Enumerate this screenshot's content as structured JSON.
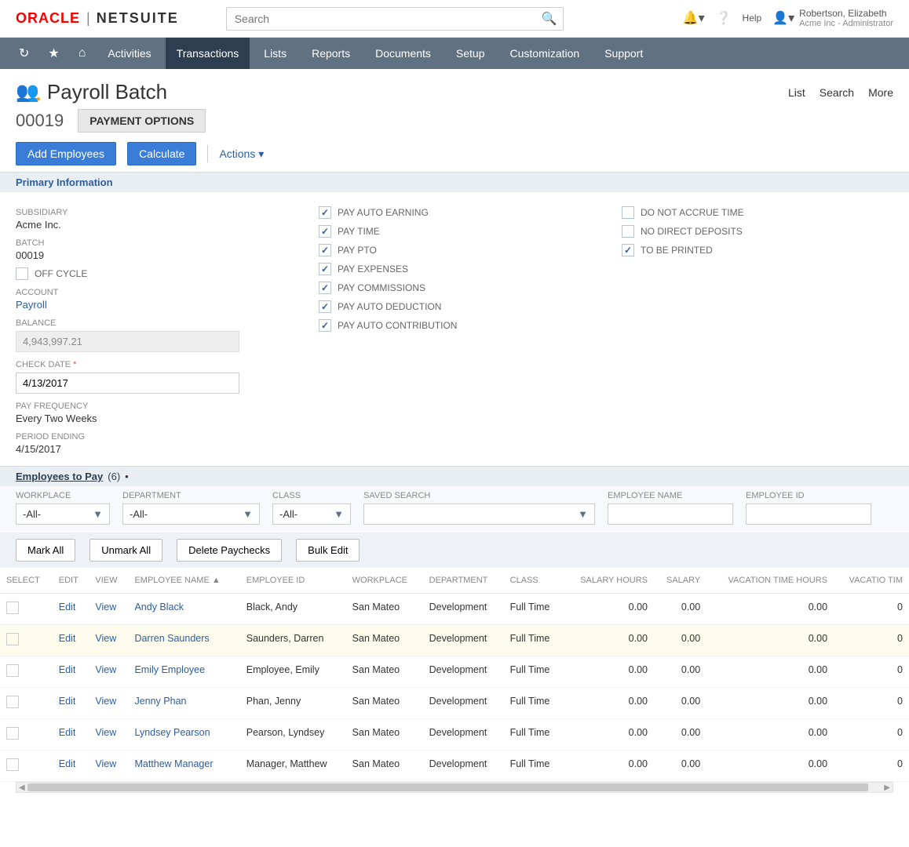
{
  "header": {
    "logo_oracle": "ORACLE",
    "logo_netsuite": "NETSUITE",
    "search_placeholder": "Search",
    "help": "Help",
    "user_name": "Robertson, Elizabeth",
    "user_role": "Acme Inc - Administrator"
  },
  "nav": [
    "Activities",
    "Transactions",
    "Lists",
    "Reports",
    "Documents",
    "Setup",
    "Customization",
    "Support"
  ],
  "nav_active": "Transactions",
  "page": {
    "title": "Payroll Batch",
    "batch_no": "00019",
    "payment_options": "PAYMENT OPTIONS",
    "top_actions": [
      "List",
      "Search",
      "More"
    ],
    "add_employees": "Add Employees",
    "calculate": "Calculate",
    "actions": "Actions"
  },
  "primary_info_header": "Primary Information",
  "col1": {
    "subsidiary_label": "SUBSIDIARY",
    "subsidiary_value": "Acme Inc.",
    "batch_label": "BATCH",
    "batch_value": "00019",
    "offcycle_label": "OFF CYCLE",
    "account_label": "ACCOUNT",
    "account_value": "Payroll",
    "balance_label": "BALANCE",
    "balance_value": "4,943,997.21",
    "checkdate_label": "CHECK DATE",
    "checkdate_value": "4/13/2017",
    "payfreq_label": "PAY FREQUENCY",
    "payfreq_value": "Every Two Weeks",
    "period_label": "PERIOD ENDING",
    "period_value": "4/15/2017"
  },
  "col2_checks": [
    {
      "label": "PAY AUTO EARNING",
      "checked": true
    },
    {
      "label": "PAY TIME",
      "checked": true
    },
    {
      "label": "PAY PTO",
      "checked": true
    },
    {
      "label": "PAY EXPENSES",
      "checked": true
    },
    {
      "label": "PAY COMMISSIONS",
      "checked": true
    },
    {
      "label": "PAY AUTO DEDUCTION",
      "checked": true
    },
    {
      "label": "PAY AUTO CONTRIBUTION",
      "checked": true
    }
  ],
  "col3_checks": [
    {
      "label": "DO NOT ACCRUE TIME",
      "checked": false
    },
    {
      "label": "NO DIRECT DEPOSITS",
      "checked": false
    },
    {
      "label": "TO BE PRINTED",
      "checked": true
    }
  ],
  "employees_tab": {
    "label": "Employees to Pay",
    "count": "(6)",
    "dot": "•"
  },
  "filters": {
    "workplace": {
      "label": "WORKPLACE",
      "value": "-All-"
    },
    "department": {
      "label": "DEPARTMENT",
      "value": "-All-"
    },
    "class": {
      "label": "CLASS",
      "value": "-All-"
    },
    "saved_search": {
      "label": "SAVED SEARCH",
      "value": ""
    },
    "emp_name": {
      "label": "EMPLOYEE NAME"
    },
    "emp_id": {
      "label": "EMPLOYEE ID"
    }
  },
  "bulk": {
    "mark_all": "Mark All",
    "unmark_all": "Unmark All",
    "delete": "Delete Paychecks",
    "bulk_edit": "Bulk Edit"
  },
  "table_headers": [
    "SELECT",
    "EDIT",
    "VIEW",
    "EMPLOYEE NAME ▲",
    "EMPLOYEE ID",
    "WORKPLACE",
    "DEPARTMENT",
    "CLASS",
    "SALARY HOURS",
    "SALARY",
    "VACATION TIME HOURS",
    "VACATIO TIM"
  ],
  "rows": [
    {
      "name": "Andy Black",
      "id": "Black, Andy",
      "wp": "San Mateo",
      "dept": "Development",
      "cls": "Full Time",
      "sh": "0.00",
      "sal": "0.00",
      "vth": "0.00",
      "vt": "0"
    },
    {
      "name": "Darren Saunders",
      "id": "Saunders, Darren",
      "wp": "San Mateo",
      "dept": "Development",
      "cls": "Full Time",
      "sh": "0.00",
      "sal": "0.00",
      "vth": "0.00",
      "vt": "0",
      "hl": true
    },
    {
      "name": "Emily Employee",
      "id": "Employee, Emily",
      "wp": "San Mateo",
      "dept": "Development",
      "cls": "Full Time",
      "sh": "0.00",
      "sal": "0.00",
      "vth": "0.00",
      "vt": "0"
    },
    {
      "name": "Jenny Phan",
      "id": "Phan, Jenny",
      "wp": "San Mateo",
      "dept": "Development",
      "cls": "Full Time",
      "sh": "0.00",
      "sal": "0.00",
      "vth": "0.00",
      "vt": "0"
    },
    {
      "name": "Lyndsey Pearson",
      "id": "Pearson, Lyndsey",
      "wp": "San Mateo",
      "dept": "Development",
      "cls": "Full Time",
      "sh": "0.00",
      "sal": "0.00",
      "vth": "0.00",
      "vt": "0"
    },
    {
      "name": "Matthew Manager",
      "id": "Manager, Matthew",
      "wp": "San Mateo",
      "dept": "Development",
      "cls": "Full Time",
      "sh": "0.00",
      "sal": "0.00",
      "vth": "0.00",
      "vt": "0"
    }
  ],
  "edit": "Edit",
  "view": "View"
}
